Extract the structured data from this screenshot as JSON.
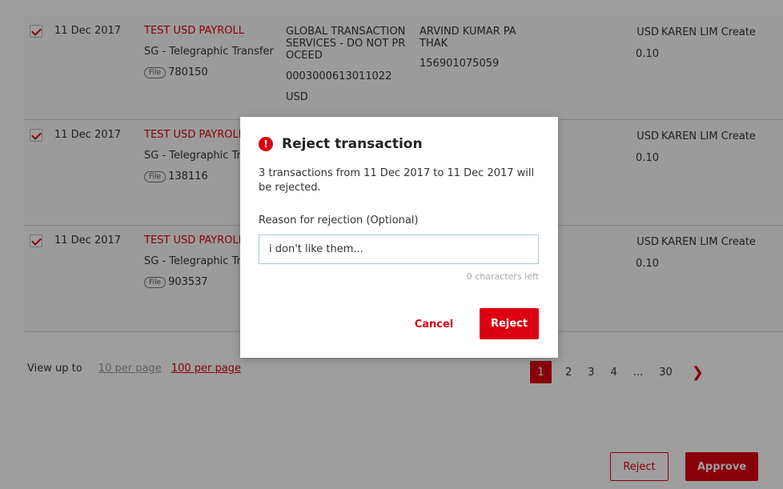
{
  "colors": {
    "accent": "#db0011",
    "overlay": "rgba(0,0,0,0.38)"
  },
  "rows": [
    {
      "checked": true,
      "date": "11 Dec 2017",
      "name": "TEST USD PAYROLL",
      "type": "SG - Telegraphic Transfer",
      "file_tag": "File",
      "file_id": "780150",
      "bene_lines": [
        "GLOBAL TRANSACTION",
        "SERVICES - DO NOT PR",
        "OCEED"
      ],
      "bene_account": "0003000613011022",
      "bene_currency": "USD",
      "account_lines": [
        "ARVIND KUMAR PA",
        "THAK"
      ],
      "account_number": "156901075059",
      "currency": "USD",
      "amount": "0.10",
      "creator": "KAREN LIM Create"
    },
    {
      "checked": true,
      "date": "11 Dec 2017",
      "name": "TEST USD PAYROLL",
      "type": "SG - Telegraphic Tr",
      "file_tag": "File",
      "file_id": "138116",
      "currency": "USD",
      "amount": "0.10",
      "creator": "KAREN LIM Create"
    },
    {
      "checked": true,
      "date": "11 Dec 2017",
      "name": "TEST USD PAYROLL",
      "type": "SG - Telegraphic Tr",
      "file_tag": "File",
      "file_id": "903537",
      "currency": "USD",
      "amount": "0.10",
      "creator": "KAREN LIM Create"
    }
  ],
  "pager": {
    "view_label": "View up to",
    "options": [
      "10 per page",
      "100 per page"
    ],
    "selected_option": "100 per page",
    "pages": [
      "1",
      "2",
      "3",
      "4",
      "...",
      "30"
    ],
    "current_page": "1",
    "next_icon": "chevron-right-icon"
  },
  "footer": {
    "reject_label": "Reject",
    "approve_label": "Approve"
  },
  "modal": {
    "icon": "exclamation-icon",
    "icon_glyph": "!",
    "title": "Reject transaction",
    "message": "3 transactions from 11 Dec 2017 to 11 Dec 2017 will be rejected.",
    "reason_label": "Reason for rejection (Optional)",
    "reason_value": "i don't like them...",
    "chars_left": "0 characters left",
    "cancel_label": "Cancel",
    "reject_label": "Reject"
  }
}
